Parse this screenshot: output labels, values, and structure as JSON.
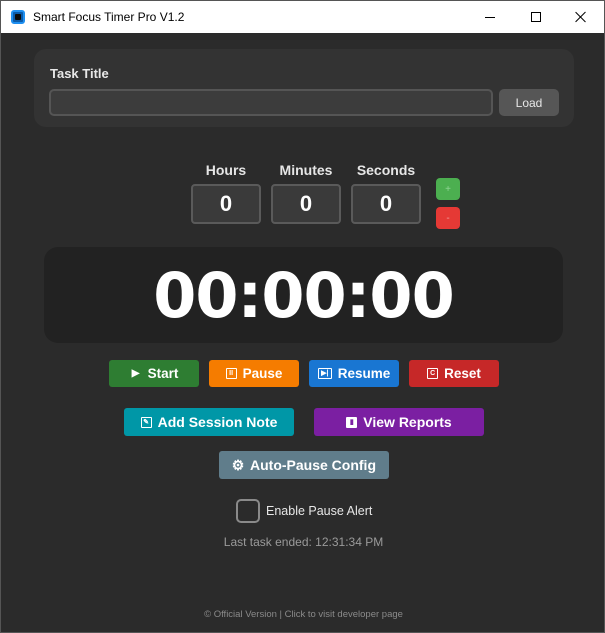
{
  "window": {
    "title": "Smart Focus Timer Pro V1.2",
    "controls": {
      "minimize": "minimize-icon",
      "maximize": "maximize-icon",
      "close": "close-icon"
    }
  },
  "task": {
    "label": "Task Title",
    "input_value": "",
    "input_placeholder": "",
    "load_label": "Load"
  },
  "time_setter": {
    "hours_label": "Hours",
    "minutes_label": "Minutes",
    "seconds_label": "Seconds",
    "hours_value": "0",
    "minutes_value": "0",
    "seconds_value": "0",
    "plus_label": "+",
    "minus_label": "-"
  },
  "timer": {
    "display": "00:00:00"
  },
  "controls": {
    "start": "Start",
    "pause": "Pause",
    "resume": "Resume",
    "reset": "Reset",
    "add_note": "Add Session Note",
    "view_reports": "View Reports",
    "auto_pause": "Auto-Pause Config"
  },
  "alert": {
    "label": "Enable Pause Alert",
    "checked": false
  },
  "status": {
    "last_task": "Last task ended: 12:31:34 PM"
  },
  "footer": {
    "text": "© Official Version | Click to visit developer page"
  },
  "colors": {
    "background": "#2b2b2b",
    "start": "#2e7d32",
    "pause": "#f57c00",
    "resume": "#1976d2",
    "reset": "#c62828",
    "note": "#0097a7",
    "reports": "#7b1fa2",
    "config": "#607d8b",
    "plus": "#4caf50",
    "minus": "#e53935"
  }
}
